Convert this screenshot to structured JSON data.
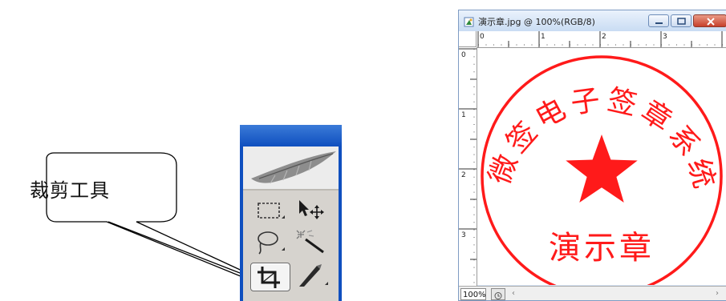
{
  "callout": {
    "text": "裁剪工具"
  },
  "toolbox": {
    "tools": [
      {
        "name": "rectangular-marquee",
        "icon": "rect-marquee-icon"
      },
      {
        "name": "move",
        "icon": "move-icon"
      },
      {
        "name": "lasso",
        "icon": "lasso-icon"
      },
      {
        "name": "magic-wand",
        "icon": "magic-wand-icon"
      },
      {
        "name": "crop",
        "icon": "crop-icon",
        "selected": true
      },
      {
        "name": "slice",
        "icon": "slice-icon"
      }
    ]
  },
  "document": {
    "title": "演示章.jpg @ 100%(RGB/8)",
    "ruler_h_labels": [
      "0",
      "1",
      "2",
      "3"
    ],
    "ruler_v_labels": [
      "0",
      "1",
      "2",
      "3"
    ],
    "zoom": "100%",
    "scroll_left_arrow": "‹",
    "scroll_right_arrow": "›",
    "stamp": {
      "arc_text": "微签电子签章系统",
      "center_text": "演示章",
      "color": "#ff1a1a"
    }
  }
}
